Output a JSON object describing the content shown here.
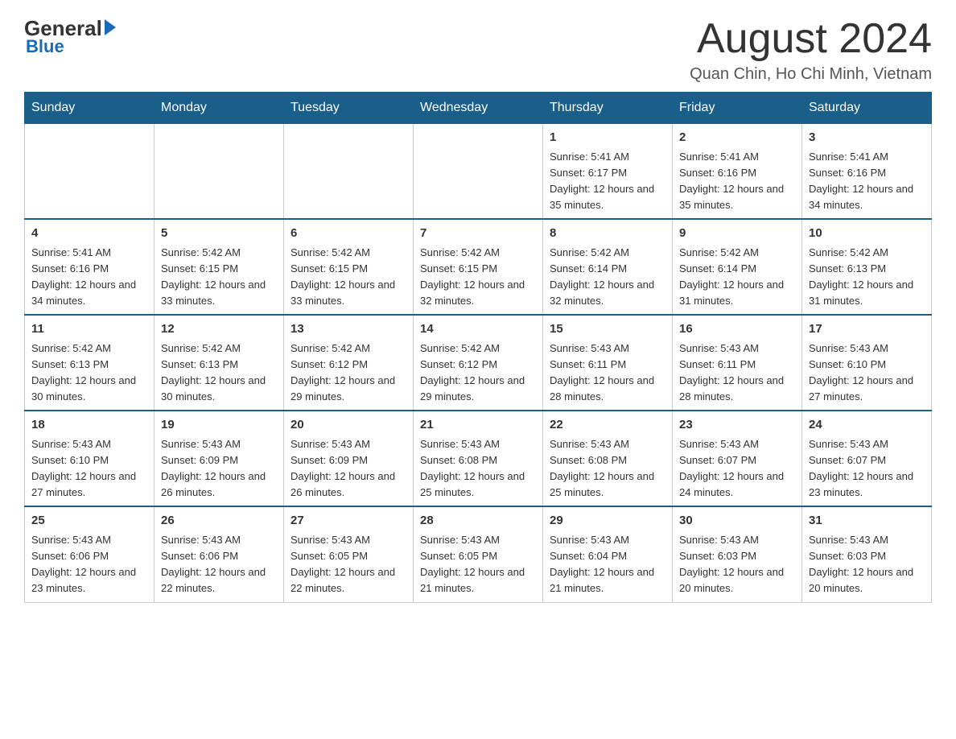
{
  "logo": {
    "general": "General",
    "blue": "Blue",
    "arrow": "▶"
  },
  "title": "August 2024",
  "subtitle": "Quan Chin, Ho Chi Minh, Vietnam",
  "days_of_week": [
    "Sunday",
    "Monday",
    "Tuesday",
    "Wednesday",
    "Thursday",
    "Friday",
    "Saturday"
  ],
  "weeks": [
    [
      {
        "day": "",
        "info": ""
      },
      {
        "day": "",
        "info": ""
      },
      {
        "day": "",
        "info": ""
      },
      {
        "day": "",
        "info": ""
      },
      {
        "day": "1",
        "info": "Sunrise: 5:41 AM\nSunset: 6:17 PM\nDaylight: 12 hours and 35 minutes."
      },
      {
        "day": "2",
        "info": "Sunrise: 5:41 AM\nSunset: 6:16 PM\nDaylight: 12 hours and 35 minutes."
      },
      {
        "day": "3",
        "info": "Sunrise: 5:41 AM\nSunset: 6:16 PM\nDaylight: 12 hours and 34 minutes."
      }
    ],
    [
      {
        "day": "4",
        "info": "Sunrise: 5:41 AM\nSunset: 6:16 PM\nDaylight: 12 hours and 34 minutes."
      },
      {
        "day": "5",
        "info": "Sunrise: 5:42 AM\nSunset: 6:15 PM\nDaylight: 12 hours and 33 minutes."
      },
      {
        "day": "6",
        "info": "Sunrise: 5:42 AM\nSunset: 6:15 PM\nDaylight: 12 hours and 33 minutes."
      },
      {
        "day": "7",
        "info": "Sunrise: 5:42 AM\nSunset: 6:15 PM\nDaylight: 12 hours and 32 minutes."
      },
      {
        "day": "8",
        "info": "Sunrise: 5:42 AM\nSunset: 6:14 PM\nDaylight: 12 hours and 32 minutes."
      },
      {
        "day": "9",
        "info": "Sunrise: 5:42 AM\nSunset: 6:14 PM\nDaylight: 12 hours and 31 minutes."
      },
      {
        "day": "10",
        "info": "Sunrise: 5:42 AM\nSunset: 6:13 PM\nDaylight: 12 hours and 31 minutes."
      }
    ],
    [
      {
        "day": "11",
        "info": "Sunrise: 5:42 AM\nSunset: 6:13 PM\nDaylight: 12 hours and 30 minutes."
      },
      {
        "day": "12",
        "info": "Sunrise: 5:42 AM\nSunset: 6:13 PM\nDaylight: 12 hours and 30 minutes."
      },
      {
        "day": "13",
        "info": "Sunrise: 5:42 AM\nSunset: 6:12 PM\nDaylight: 12 hours and 29 minutes."
      },
      {
        "day": "14",
        "info": "Sunrise: 5:42 AM\nSunset: 6:12 PM\nDaylight: 12 hours and 29 minutes."
      },
      {
        "day": "15",
        "info": "Sunrise: 5:43 AM\nSunset: 6:11 PM\nDaylight: 12 hours and 28 minutes."
      },
      {
        "day": "16",
        "info": "Sunrise: 5:43 AM\nSunset: 6:11 PM\nDaylight: 12 hours and 28 minutes."
      },
      {
        "day": "17",
        "info": "Sunrise: 5:43 AM\nSunset: 6:10 PM\nDaylight: 12 hours and 27 minutes."
      }
    ],
    [
      {
        "day": "18",
        "info": "Sunrise: 5:43 AM\nSunset: 6:10 PM\nDaylight: 12 hours and 27 minutes."
      },
      {
        "day": "19",
        "info": "Sunrise: 5:43 AM\nSunset: 6:09 PM\nDaylight: 12 hours and 26 minutes."
      },
      {
        "day": "20",
        "info": "Sunrise: 5:43 AM\nSunset: 6:09 PM\nDaylight: 12 hours and 26 minutes."
      },
      {
        "day": "21",
        "info": "Sunrise: 5:43 AM\nSunset: 6:08 PM\nDaylight: 12 hours and 25 minutes."
      },
      {
        "day": "22",
        "info": "Sunrise: 5:43 AM\nSunset: 6:08 PM\nDaylight: 12 hours and 25 minutes."
      },
      {
        "day": "23",
        "info": "Sunrise: 5:43 AM\nSunset: 6:07 PM\nDaylight: 12 hours and 24 minutes."
      },
      {
        "day": "24",
        "info": "Sunrise: 5:43 AM\nSunset: 6:07 PM\nDaylight: 12 hours and 23 minutes."
      }
    ],
    [
      {
        "day": "25",
        "info": "Sunrise: 5:43 AM\nSunset: 6:06 PM\nDaylight: 12 hours and 23 minutes."
      },
      {
        "day": "26",
        "info": "Sunrise: 5:43 AM\nSunset: 6:06 PM\nDaylight: 12 hours and 22 minutes."
      },
      {
        "day": "27",
        "info": "Sunrise: 5:43 AM\nSunset: 6:05 PM\nDaylight: 12 hours and 22 minutes."
      },
      {
        "day": "28",
        "info": "Sunrise: 5:43 AM\nSunset: 6:05 PM\nDaylight: 12 hours and 21 minutes."
      },
      {
        "day": "29",
        "info": "Sunrise: 5:43 AM\nSunset: 6:04 PM\nDaylight: 12 hours and 21 minutes."
      },
      {
        "day": "30",
        "info": "Sunrise: 5:43 AM\nSunset: 6:03 PM\nDaylight: 12 hours and 20 minutes."
      },
      {
        "day": "31",
        "info": "Sunrise: 5:43 AM\nSunset: 6:03 PM\nDaylight: 12 hours and 20 minutes."
      }
    ]
  ]
}
